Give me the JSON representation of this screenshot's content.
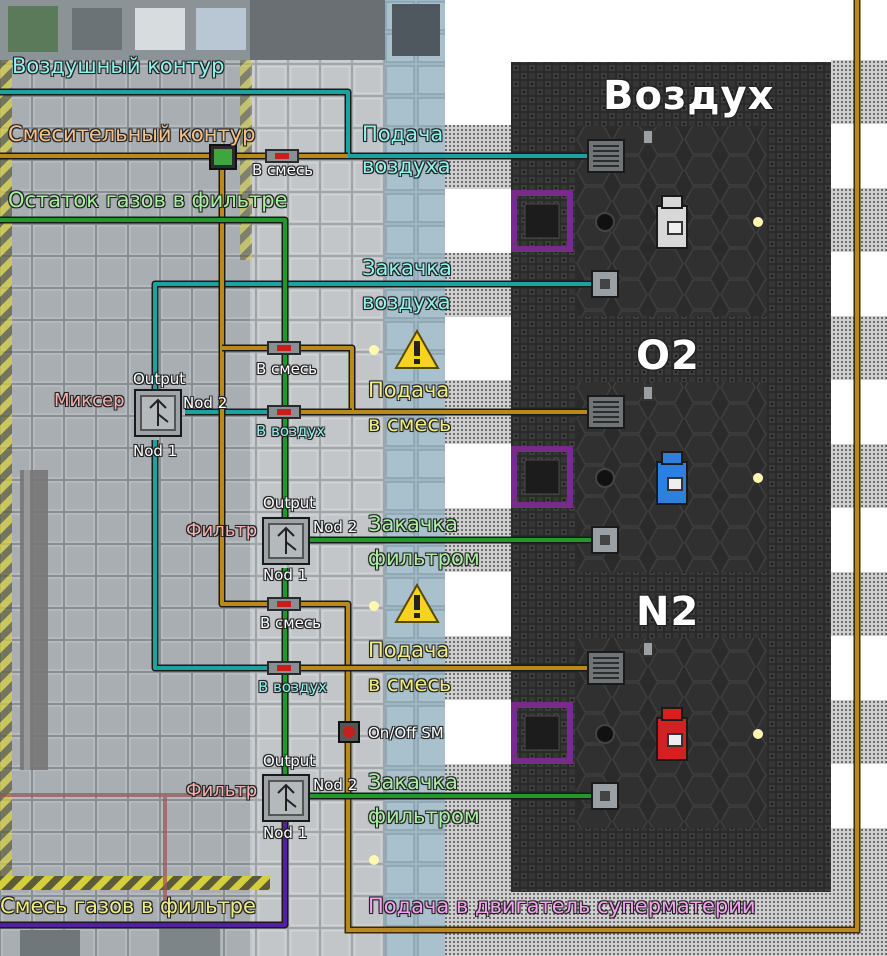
{
  "loop_labels": {
    "air_loop": "Воздушный контур",
    "mix_loop": "Смесительный контур",
    "filter_residue": "Остаток газов в фильтре",
    "filter_mix": "Смесь газов в фильтре",
    "sm_feed": "Подача в двигатель суперматерии"
  },
  "chambers": {
    "air": {
      "title": "Воздух",
      "supply_line1": "Подача",
      "supply_line2": "воздуха",
      "pump_line1": "Закачка",
      "pump_line2": "воздуха",
      "canister_color": "#d8d8d8"
    },
    "o2": {
      "title": "O2",
      "supply_line1": "Подача",
      "supply_line2": "в смесь",
      "pump_line1": "Закачка",
      "pump_line2": "фильтром",
      "canister_color": "#2d7fe0"
    },
    "n2": {
      "title": "N2",
      "supply_line1": "Подача",
      "supply_line2": "в смесь",
      "pump_line1": "Закачка",
      "pump_line2": "фильтром",
      "canister_color": "#d42020"
    }
  },
  "valves": {
    "to_mix_top": "В смесь",
    "to_mix_o2": "В смесь",
    "to_air_o2": "В воздух",
    "to_mix_n2": "В смесь",
    "to_air_n2": "В воздух"
  },
  "mixer": {
    "name": "Миксер",
    "output": "Output",
    "node2": "Nod 2",
    "node1": "Nod 1"
  },
  "filter_o2": {
    "name": "Фильтр",
    "output": "Output",
    "node2": "Nod 2",
    "node1": "Nod 1"
  },
  "filter_n2": {
    "name": "Фильтр",
    "output": "Output",
    "node2": "Nod 2",
    "node1": "Nod 1"
  },
  "sm_switch": {
    "label": "On/Off SM"
  },
  "pipe_colors": {
    "air": "#1aa3a0",
    "mix": "#b88a1c",
    "filter": "#1f9a2a",
    "filtered_mix": "#5520a0"
  }
}
